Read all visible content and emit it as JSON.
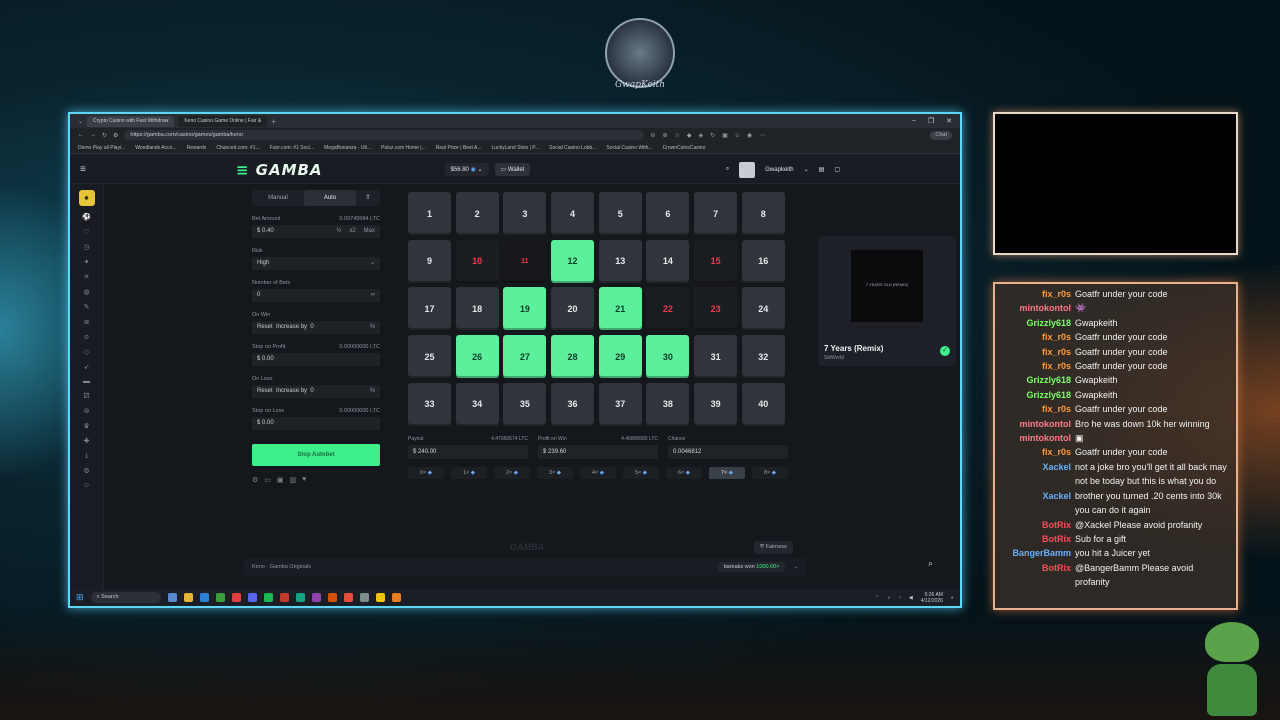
{
  "overlay": {
    "logo_text": "GwapKeith"
  },
  "browser": {
    "tabs": [
      "Crypto Casino with Fast Withdraw",
      "Keno Casino Game Online | Fair &"
    ],
    "url": "https://gamba.com/casino/games/gamba/keno",
    "chat_label": "Chat",
    "bookmarks": [
      "Demo Play all Playi...",
      "Woodlands Acco...",
      "Rewards",
      "Chanced.com: #1...",
      "Funr.com: #1 Soci...",
      "MegaBonanza - Ult...",
      "Pulsz.com Home |...",
      "Real Prize | Best A...",
      "LuckyLand Slots | P...",
      "Social Casino Lobb...",
      "Social Casino With...",
      "CrownCoinsCasino"
    ]
  },
  "site": {
    "brand": "GAMBA",
    "balance": "$56.80",
    "wallet_label": "Wallet",
    "username": "Gwapkeith"
  },
  "controls": {
    "tabs": [
      "Manual",
      "Auto"
    ],
    "bet_amount_label": "Bet Amount",
    "bet_amount_ltc": "0.00745584 LTC",
    "bet_amount_value": "0.40",
    "half": "½",
    "double": "x2",
    "max": "Max",
    "risk_label": "Risk",
    "risk_value": "High",
    "num_bets_label": "Number of Bets",
    "num_bets_value": "0",
    "on_win_label": "On Win",
    "reset": "Reset",
    "increase_by": "Increase by",
    "on_win_value": "0",
    "pct": "%",
    "stop_profit_label": "Stop on Profit",
    "stop_profit_ltc": "0.00000000 LTC",
    "stop_profit_value": "0.00",
    "on_loss_label": "On Loss",
    "on_loss_value": "0",
    "stop_loss_label": "Stop on Loss",
    "stop_loss_ltc": "0.00000000 LTC",
    "stop_loss_value": "0.00",
    "stop_button": "Stop Autobet"
  },
  "board": {
    "cells": [
      {
        "n": "1",
        "s": ""
      },
      {
        "n": "2",
        "s": ""
      },
      {
        "n": "3",
        "s": ""
      },
      {
        "n": "4",
        "s": ""
      },
      {
        "n": "5",
        "s": ""
      },
      {
        "n": "6",
        "s": ""
      },
      {
        "n": "7",
        "s": ""
      },
      {
        "n": "8",
        "s": ""
      },
      {
        "n": "9",
        "s": ""
      },
      {
        "n": "10",
        "s": "miss"
      },
      {
        "n": "11",
        "s": "pickmiss"
      },
      {
        "n": "12",
        "s": "hit"
      },
      {
        "n": "13",
        "s": ""
      },
      {
        "n": "14",
        "s": ""
      },
      {
        "n": "15",
        "s": "miss"
      },
      {
        "n": "16",
        "s": ""
      },
      {
        "n": "17",
        "s": ""
      },
      {
        "n": "18",
        "s": ""
      },
      {
        "n": "19",
        "s": "hit"
      },
      {
        "n": "20",
        "s": ""
      },
      {
        "n": "21",
        "s": "hit"
      },
      {
        "n": "22",
        "s": "miss"
      },
      {
        "n": "23",
        "s": "miss"
      },
      {
        "n": "24",
        "s": ""
      },
      {
        "n": "25",
        "s": ""
      },
      {
        "n": "26",
        "s": "hit"
      },
      {
        "n": "27",
        "s": "hit"
      },
      {
        "n": "28",
        "s": "hit"
      },
      {
        "n": "29",
        "s": "hit"
      },
      {
        "n": "30",
        "s": "hit"
      },
      {
        "n": "31",
        "s": ""
      },
      {
        "n": "32",
        "s": ""
      },
      {
        "n": "33",
        "s": ""
      },
      {
        "n": "34",
        "s": ""
      },
      {
        "n": "35",
        "s": ""
      },
      {
        "n": "36",
        "s": ""
      },
      {
        "n": "37",
        "s": ""
      },
      {
        "n": "38",
        "s": ""
      },
      {
        "n": "39",
        "s": ""
      },
      {
        "n": "40",
        "s": ""
      }
    ],
    "payout_label": "Payout",
    "payout_ltc": "4.47950674 LTC",
    "payout_value": "240.00",
    "profit_label": "Profit on Win",
    "profit_ltc": "4.46805680 LTC",
    "profit_value": "239.60",
    "chance_label": "Chance",
    "chance_value": "0.0046812",
    "multipliers": [
      "0×",
      "1×",
      "2×",
      "3×",
      "4×",
      "5×",
      "6×",
      "7×",
      "8×"
    ],
    "active_multiplier_index": 7
  },
  "footer": {
    "fairness": "Fairness",
    "watermark": "GAMBA",
    "breadcrumb": "Keno · Gamba Originals",
    "bigwin_user": "bareaks",
    "bigwin_text": "won",
    "bigwin_amount": "1000.00×"
  },
  "song": {
    "title": "7 Years (Remix)",
    "artist": "SikWorld",
    "art_text": "7 YEARS OLD (REMIX)"
  },
  "taskbar": {
    "search": "Search",
    "time": "6:26 AM",
    "date": "4/12/2026"
  },
  "chat": {
    "colors": {
      "orange": "#ff9a3c",
      "pink": "#ff7a8a",
      "green": "#7dff6a",
      "blue": "#6ab0ff",
      "red": "#ff4a5a"
    },
    "messages": [
      {
        "user": "fix_r0s",
        "color": "#ff9a3c",
        "text": "Goatfr under your code"
      },
      {
        "user": "mintokontol",
        "color": "#ff7a8a",
        "text": "👾"
      },
      {
        "user": "Grizzly618",
        "color": "#7dff6a",
        "text": "Gwapkeith"
      },
      {
        "user": "fix_r0s",
        "color": "#ff9a3c",
        "text": "Goatfr under your code"
      },
      {
        "user": "fix_r0s",
        "color": "#ff9a3c",
        "text": "Goatfr under your code"
      },
      {
        "user": "fix_r0s",
        "color": "#ff9a3c",
        "text": "Goatfr under your code"
      },
      {
        "user": "Grizzly618",
        "color": "#7dff6a",
        "text": "Gwapkeith"
      },
      {
        "user": "Grizzly618",
        "color": "#7dff6a",
        "text": "Gwapkeith"
      },
      {
        "user": "fix_r0s",
        "color": "#ff9a3c",
        "text": "Goatfr under your code"
      },
      {
        "user": "mintokontol",
        "color": "#ff7a8a",
        "text": "Bro he was down 10k her winning"
      },
      {
        "user": "mintokontol",
        "color": "#ff7a8a",
        "text": "▣"
      },
      {
        "user": "fix_r0s",
        "color": "#ff9a3c",
        "text": "Goatfr under your code"
      },
      {
        "user": "Xackel",
        "color": "#6ab0ff",
        "text": "not a joke bro you'll get it all back may not be today but this is what you do"
      },
      {
        "user": "Xackel",
        "color": "#6ab0ff",
        "text": "brother you turned .20 cents into 30k you can do it again"
      },
      {
        "user": "BotRix",
        "color": "#ff4a5a",
        "text": "@Xackel Please avoid profanity"
      },
      {
        "user": "BotRix",
        "color": "#ff4a5a",
        "text": "Sub for a gift"
      },
      {
        "user": "BangerBamm",
        "color": "#6ab0ff",
        "text": "you hit a Juicer yet"
      },
      {
        "user": "BotRix",
        "color": "#ff4a5a",
        "text": "@BangerBamm Please avoid profanity"
      }
    ]
  }
}
